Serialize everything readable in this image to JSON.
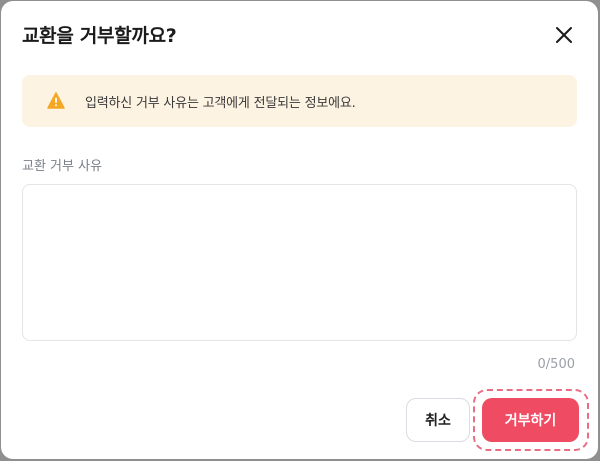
{
  "dialog": {
    "title": "교환을 거부할까요?",
    "close_icon": "close-icon"
  },
  "notice": {
    "icon": "warning-icon",
    "icon_color": "#f5a623",
    "text": "입력하신 거부 사유는 고객에게 전달되는 정보에요.",
    "background": "#fdf3e2"
  },
  "reason": {
    "label": "교환 거부 사유",
    "value": "",
    "counter": "0/500"
  },
  "actions": {
    "cancel_label": "취소",
    "reject_label": "거부하기",
    "reject_color": "#ef4b62"
  }
}
